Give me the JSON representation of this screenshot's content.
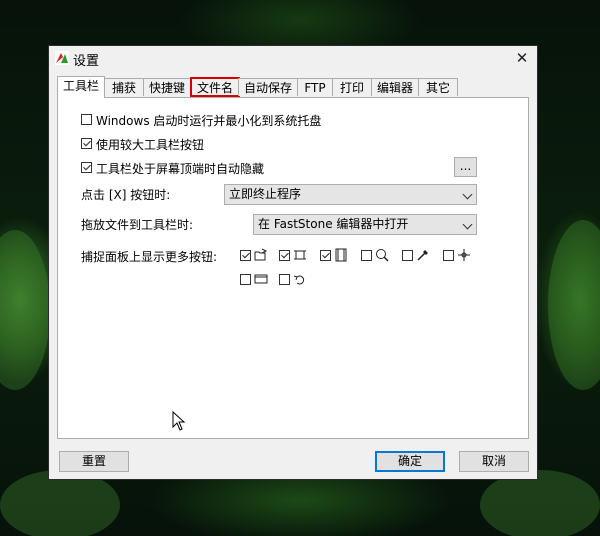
{
  "window": {
    "title": "设置",
    "close_glyph": "✕"
  },
  "tabs": [
    {
      "label": "工具栏",
      "active": true
    },
    {
      "label": "捕获"
    },
    {
      "label": "快捷键"
    },
    {
      "label": "文件名",
      "highlighted": true
    },
    {
      "label": "自动保存"
    },
    {
      "label": "FTP"
    },
    {
      "label": "打印"
    },
    {
      "label": "编辑器"
    },
    {
      "label": "其它"
    }
  ],
  "options": {
    "start_minimized": {
      "label": "Windows 启动时运行并最小化到系统托盘",
      "checked": false
    },
    "larger_buttons": {
      "label": "使用较大工具栏按钮",
      "checked": true
    },
    "auto_hide": {
      "label": "工具栏处于屏幕顶端时自动隐藏",
      "checked": true
    },
    "more_button": "..."
  },
  "close_button_action": {
    "label": "点击 [X] 按钮时:",
    "value": "立即终止程序"
  },
  "drag_file_action": {
    "label": "拖放文件到工具栏时:",
    "value": "在 FastStone 编辑器中打开"
  },
  "capture_buttons": {
    "label": "捕捉面板上显示更多按钮:",
    "items": [
      {
        "icon": "open-folder-icon",
        "checked": true
      },
      {
        "icon": "crop-region-icon",
        "checked": true
      },
      {
        "icon": "film-video-icon",
        "checked": true
      },
      {
        "icon": "magnifier-icon",
        "checked": false
      },
      {
        "icon": "eyedropper-icon",
        "checked": false
      },
      {
        "icon": "crosshair-icon",
        "checked": false
      },
      {
        "icon": "screen-capture-icon",
        "checked": false
      },
      {
        "icon": "undo-icon",
        "checked": false
      }
    ]
  },
  "footer": {
    "reset_label": "重置",
    "ok_label": "确定",
    "cancel_label": "取消"
  },
  "colors": {
    "highlight": "#d40000",
    "primary_border": "#0078d7"
  }
}
